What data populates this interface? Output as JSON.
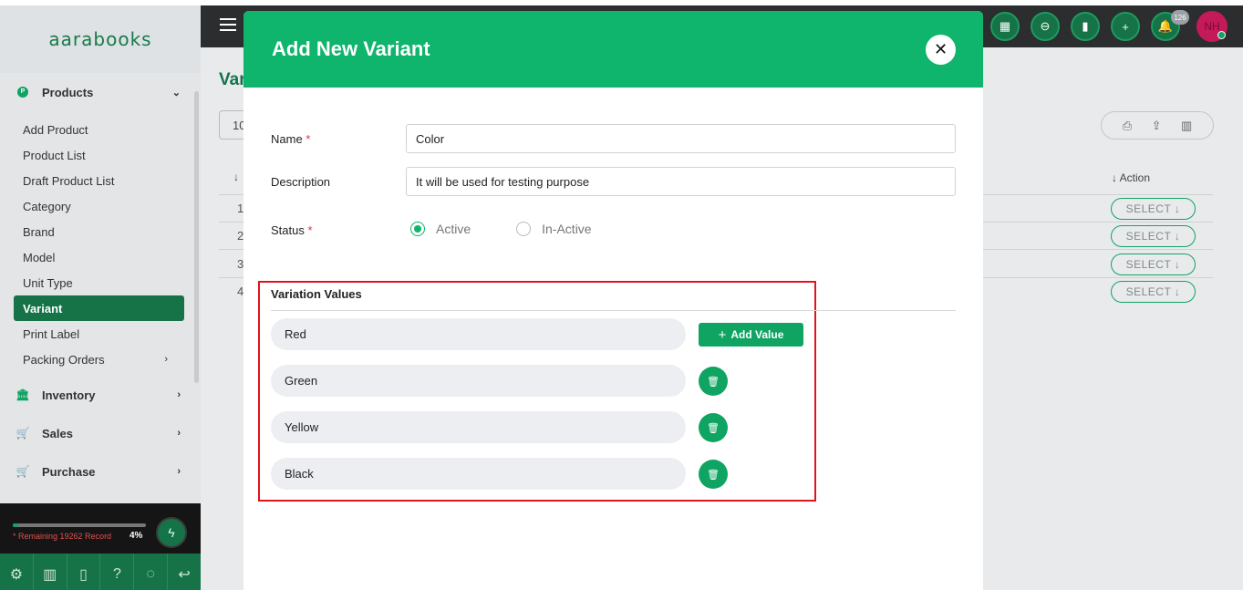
{
  "app": {
    "logo_text": "aarabooks"
  },
  "sidebar": {
    "sections": [
      {
        "label": "Products",
        "icon": "products-icon"
      },
      {
        "label": "Inventory",
        "icon": "bank-icon"
      },
      {
        "label": "Sales",
        "icon": "cart-icon"
      },
      {
        "label": "Purchase",
        "icon": "cart-icon"
      }
    ],
    "product_items": [
      "Add Product",
      "Product List",
      "Draft Product List",
      "Category",
      "Brand",
      "Model",
      "Unit Type",
      "Variant",
      "Print Label",
      "Packing Orders"
    ],
    "active_item": "Variant",
    "remaining_text": "* Remaining 19262 Record",
    "remaining_percent": "4%",
    "progress_value": 0.04
  },
  "topbar": {
    "notification_count": "126",
    "avatar_initials": "NH"
  },
  "background_page": {
    "title_fragment": "Var",
    "page_size_fragment": "10",
    "row_numbers": [
      "1",
      "2",
      "3",
      "4"
    ],
    "action_header": "↓ Action",
    "select_label": "SELECT ↓"
  },
  "modal": {
    "title": "Add New Variant",
    "name_label": "Name",
    "name_value": "Color",
    "description_label": "Description",
    "description_value": "It will be used for testing purpose",
    "status_label": "Status",
    "status_options": [
      "Active",
      "In-Active"
    ],
    "status_selected": "Active",
    "required_mark": "*",
    "variation_title": "Variation Values",
    "variation_values": [
      "Red",
      "Green",
      "Yellow",
      "Black"
    ],
    "add_value_label": "Add Value"
  },
  "colors": {
    "brand_green": "#0fb46d",
    "dark_green": "#157347",
    "highlight_red": "#e0141b"
  }
}
